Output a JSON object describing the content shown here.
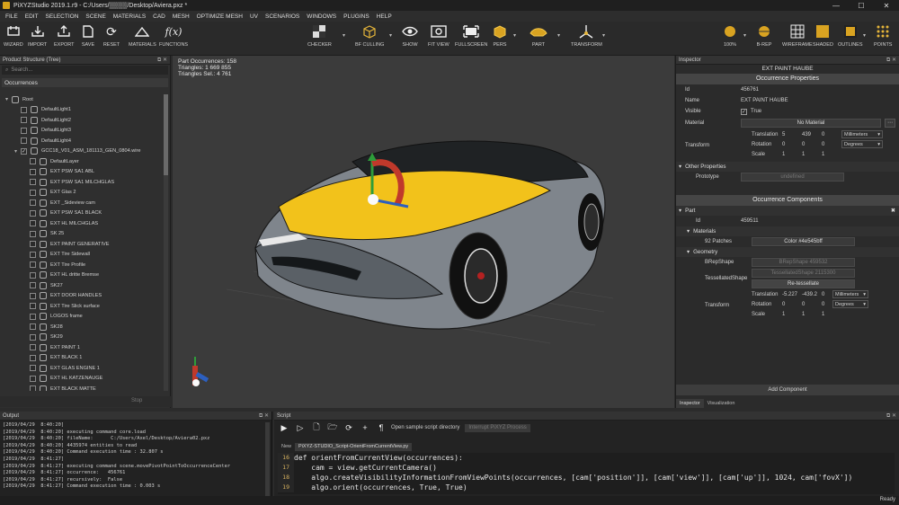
{
  "window": {
    "title": "PiXYZStudio 2019.1.r9 - C:/Users/▒▒▒▒/Desktop/Aviera.pxz *",
    "controls": [
      "—",
      "☐",
      "✕"
    ]
  },
  "menu": [
    "FILE",
    "EDIT",
    "SELECTION",
    "SCENE",
    "MATERIALS",
    "CAD",
    "MESH",
    "OPTIMIZE MESH",
    "UV",
    "SCENARIOS",
    "WINDOWS",
    "PLUGINS",
    "HELP"
  ],
  "toolbar": {
    "wizard": "WIZARD",
    "import": "IMPORT",
    "export": "EXPORT",
    "save": "SAVE",
    "reset": "RESET",
    "materials": "MATERIALS",
    "functions": "FUNCTIONS",
    "checker": "CHECKER",
    "bf_culling": "BF CULLING",
    "show": "SHOW",
    "fit_view": "FIT VIEW",
    "fullscreen": "FULLSCREEN",
    "pers": "PERS",
    "part": "PART",
    "transform": "TRANSFORM",
    "zoom": "100%",
    "brep": "B-REP",
    "wireframe": "WIREFRAME",
    "shaded": "SHADED",
    "outlines": "OUTLINES",
    "points": "POINTS",
    "functions_glyph": "f(x)"
  },
  "left_panel": {
    "title": "Product Structure (Tree)",
    "search_placeholder": "Search...",
    "header": "Occurrences",
    "stop_label": "Stop",
    "items": [
      {
        "label": "Root",
        "level": 0,
        "checkbox": false,
        "expander": "▾"
      },
      {
        "label": "DefaultLight1",
        "level": 1,
        "checkbox": true,
        "checked": false
      },
      {
        "label": "DefaultLight2",
        "level": 1,
        "checkbox": true,
        "checked": false
      },
      {
        "label": "DefaultLight3",
        "level": 1,
        "checkbox": true,
        "checked": false
      },
      {
        "label": "DefaultLight4",
        "level": 1,
        "checkbox": true,
        "checked": false
      },
      {
        "label": "GCC18_V01_ASM_181113_GEN_0804.wire",
        "level": 1,
        "checkbox": true,
        "checked": true,
        "expander": "▾"
      },
      {
        "label": "DefaultLayer",
        "level": 2,
        "checkbox": true,
        "checked": false
      },
      {
        "label": "EXT PSW SA1 ABL",
        "level": 2,
        "checkbox": true,
        "checked": false
      },
      {
        "label": "EXT PSW SA1 MILCHGLAS",
        "level": 2,
        "checkbox": true,
        "checked": false
      },
      {
        "label": "EXT Glas 2",
        "level": 2,
        "checkbox": true,
        "checked": false
      },
      {
        "label": "EXT _Sideview cam",
        "level": 2,
        "checkbox": true,
        "checked": false
      },
      {
        "label": "EXT PSW SA1 BLACK",
        "level": 2,
        "checkbox": true,
        "checked": false
      },
      {
        "label": "EXT HL MILCHGLAS",
        "level": 2,
        "checkbox": true,
        "checked": false
      },
      {
        "label": "SK 25",
        "level": 2,
        "checkbox": true,
        "checked": false
      },
      {
        "label": "EXT PAINT GENERATIVE",
        "level": 2,
        "checkbox": true,
        "checked": false
      },
      {
        "label": "EXT Tire Sidewall",
        "level": 2,
        "checkbox": true,
        "checked": false
      },
      {
        "label": "EXT Tire Profile",
        "level": 2,
        "checkbox": true,
        "checked": false
      },
      {
        "label": "EXT HL dritte Bremse",
        "level": 2,
        "checkbox": true,
        "checked": false
      },
      {
        "label": "SK27",
        "level": 2,
        "checkbox": true,
        "checked": false
      },
      {
        "label": "EXT DOOR HANDLES",
        "level": 2,
        "checkbox": true,
        "checked": false
      },
      {
        "label": "EXT Tire Slick surface",
        "level": 2,
        "checkbox": true,
        "checked": false
      },
      {
        "label": "LOGOS frame",
        "level": 2,
        "checkbox": true,
        "checked": false
      },
      {
        "label": "SK28",
        "level": 2,
        "checkbox": true,
        "checked": false
      },
      {
        "label": "SK29",
        "level": 2,
        "checkbox": true,
        "checked": false
      },
      {
        "label": "EXT PAINT 1",
        "level": 2,
        "checkbox": true,
        "checked": false
      },
      {
        "label": "EXT BLACK 1",
        "level": 2,
        "checkbox": true,
        "checked": false
      },
      {
        "label": "EXT GLAS ENGINE 1",
        "level": 2,
        "checkbox": true,
        "checked": false
      },
      {
        "label": "EXT HL KATZENAUGE",
        "level": 2,
        "checkbox": true,
        "checked": false
      },
      {
        "label": "EXT BLACK MATTE",
        "level": 2,
        "checkbox": true,
        "checked": false
      }
    ]
  },
  "viewport": {
    "stats": [
      "Part Occurrences: 158",
      "Triangles: 1 669 855",
      "Triangles Sel.: 4 761"
    ]
  },
  "inspector": {
    "title": "Inspector",
    "object_name": "EXT PAINT HAUBE",
    "occ_props_header": "Occurrence Properties",
    "id_label": "Id",
    "id_value": "456761",
    "name_label": "Name",
    "name_value": "EXT PAINT HAUBE",
    "visible_label": "Visible",
    "visible_value": "True",
    "material_label": "Material",
    "material_value": "No Material",
    "transform_label": "Transform",
    "translation_label": "Translation",
    "translation_values": [
      "5",
      "439",
      "0"
    ],
    "translation_unit": "Millimeters",
    "rotation_label": "Rotation",
    "rotation_values": [
      "0",
      "0",
      "0"
    ],
    "rotation_unit": "Degrees",
    "scale_label": "Scale",
    "scale_values": [
      "1",
      "1",
      "1"
    ],
    "other_props": "Other Properties",
    "prototype_label": "Prototype",
    "prototype_value": "undefined",
    "components_header": "Occurrence Components",
    "part_label": "Part",
    "part_id_label": "Id",
    "part_id_value": "459511",
    "materials_label": "Materials",
    "patches_label": "92 Patches",
    "patches_value": "Color #4e545bff",
    "geometry_label": "Geometry",
    "brep_label": "BRepShape",
    "brep_value": "BRepShape 459532",
    "tess_label": "TessellatedShape",
    "tess_value": "TessellatedShape 2115300",
    "retess_button": "Re-tessellate",
    "ctransform_label": "Transform",
    "ctranslation_values": [
      "-5.227",
      "-439.2",
      "0"
    ],
    "ctranslation_unit": "Millimeters",
    "crotation_values": [
      "0",
      "0",
      "0"
    ],
    "crotation_unit": "Degrees",
    "cscale_values": [
      "1",
      "1",
      "1"
    ],
    "add_component": "Add Component",
    "tabs": [
      "Inspector",
      "Visualization"
    ]
  },
  "output": {
    "title": "Output",
    "lines": [
      "[2019/04/29  8:40:20]",
      "[2019/04/29  8:40:20] executing command core.load",
      "[2019/04/29  8:40:20] fileName:      C:/Users/Axel/Desktop/Aviera02.pxz",
      "[2019/04/29  8:40:20] 4435974 entities to read",
      "[2019/04/29  8:40:20] Command execution time : 32.807 s",
      "[2019/04/29  8:41:27]",
      "[2019/04/29  8:41:27] executing command scene.movePivotPointToOccurrenceCenter",
      "[2019/04/29  8:41:27] occurrence:   456761",
      "[2019/04/29  8:41:27] recursively:  False",
      "[2019/04/29  8:41:27] Command execution time : 0.003 s"
    ]
  },
  "script": {
    "title": "Script",
    "open_dir": "Open sample script directory",
    "interrupt": "Interrupt PiXYZ Process",
    "tabs": [
      "New",
      "PiXYZ-STUDIO_Script-OrientFromCurrentView.py"
    ],
    "code": [
      {
        "ln": "16",
        "text": "def orientFromCurrentView(occurrences):"
      },
      {
        "ln": "17",
        "text": "    cam = view.getCurrentCamera()"
      },
      {
        "ln": "18",
        "text": "    algo.createVisibilityInformationFromViewPoints(occurrences, [cam['position']], [cam['view']], [cam['up']], 1024, cam['fovX'])"
      },
      {
        "ln": "19",
        "text": "    algo.orient(occurrences, True, True)"
      }
    ]
  },
  "status": "Ready",
  "colors": {
    "highlight": "#f2c21b",
    "accent": "#d6a21c"
  }
}
